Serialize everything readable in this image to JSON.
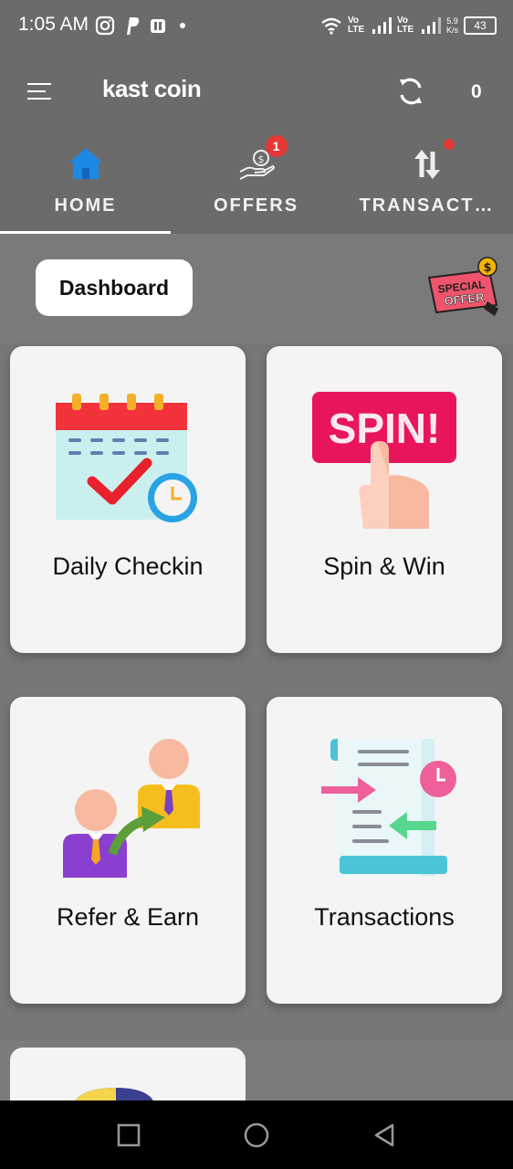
{
  "status": {
    "time": "1:05 AM",
    "net_speed_value": "5.9",
    "net_speed_unit": "K/s",
    "battery": "43",
    "sim1": "Vo LTE",
    "sim2": "Vo LTE"
  },
  "app_bar": {
    "title": "kast coin",
    "coin_count": "0"
  },
  "tabs": [
    {
      "label": "HOME",
      "icon": "home-icon",
      "active": true
    },
    {
      "label": "OFFERS",
      "icon": "money-hand-icon",
      "badge": "1"
    },
    {
      "label": "TRANSACT…",
      "icon": "transfer-arrows-icon",
      "dot": true
    }
  ],
  "dashboard": {
    "button_label": "Dashboard",
    "special_offer_top": "SPECIAL",
    "special_offer_bottom": "OFFER"
  },
  "cards": [
    {
      "label": "Daily Checkin",
      "icon": "calendar-check-icon"
    },
    {
      "label": "Spin & Win",
      "icon": "spin-icon",
      "art_text": "SPIN!"
    },
    {
      "label": "Refer & Earn",
      "icon": "refer-people-icon"
    },
    {
      "label": "Transactions",
      "icon": "transactions-scroll-icon"
    }
  ],
  "colors": {
    "overlay": "#777777",
    "card": "#f4f4f4",
    "badge": "#e53935",
    "home_icon": "#1e88e5"
  }
}
